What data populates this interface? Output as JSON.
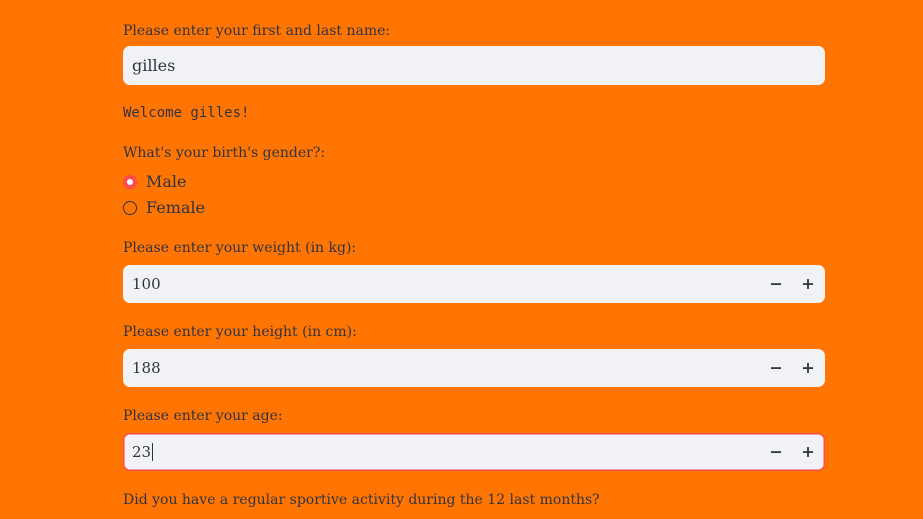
{
  "name_field": {
    "label": "Please enter your first and last name:",
    "value": "gilles"
  },
  "welcome_text": "Welcome gilles!",
  "gender": {
    "label": "What's your birth's gender?:",
    "options": [
      "Male",
      "Female"
    ],
    "selected": "Male"
  },
  "weight": {
    "label": "Please enter your weight (in kg):",
    "value": "100"
  },
  "height": {
    "label": "Please enter your height (in cm):",
    "value": "188"
  },
  "age": {
    "label": "Please enter your age:",
    "value": "23"
  },
  "sport_question": {
    "label": "Did you have a regular sportive activity during the 12 last months?"
  },
  "icons": {
    "decrement": "minus-icon",
    "increment": "plus-icon"
  },
  "colors": {
    "background": "#FF7504",
    "input_background": "#F0F2F6",
    "accent": "#FF4B4B",
    "text": "#31333F"
  }
}
